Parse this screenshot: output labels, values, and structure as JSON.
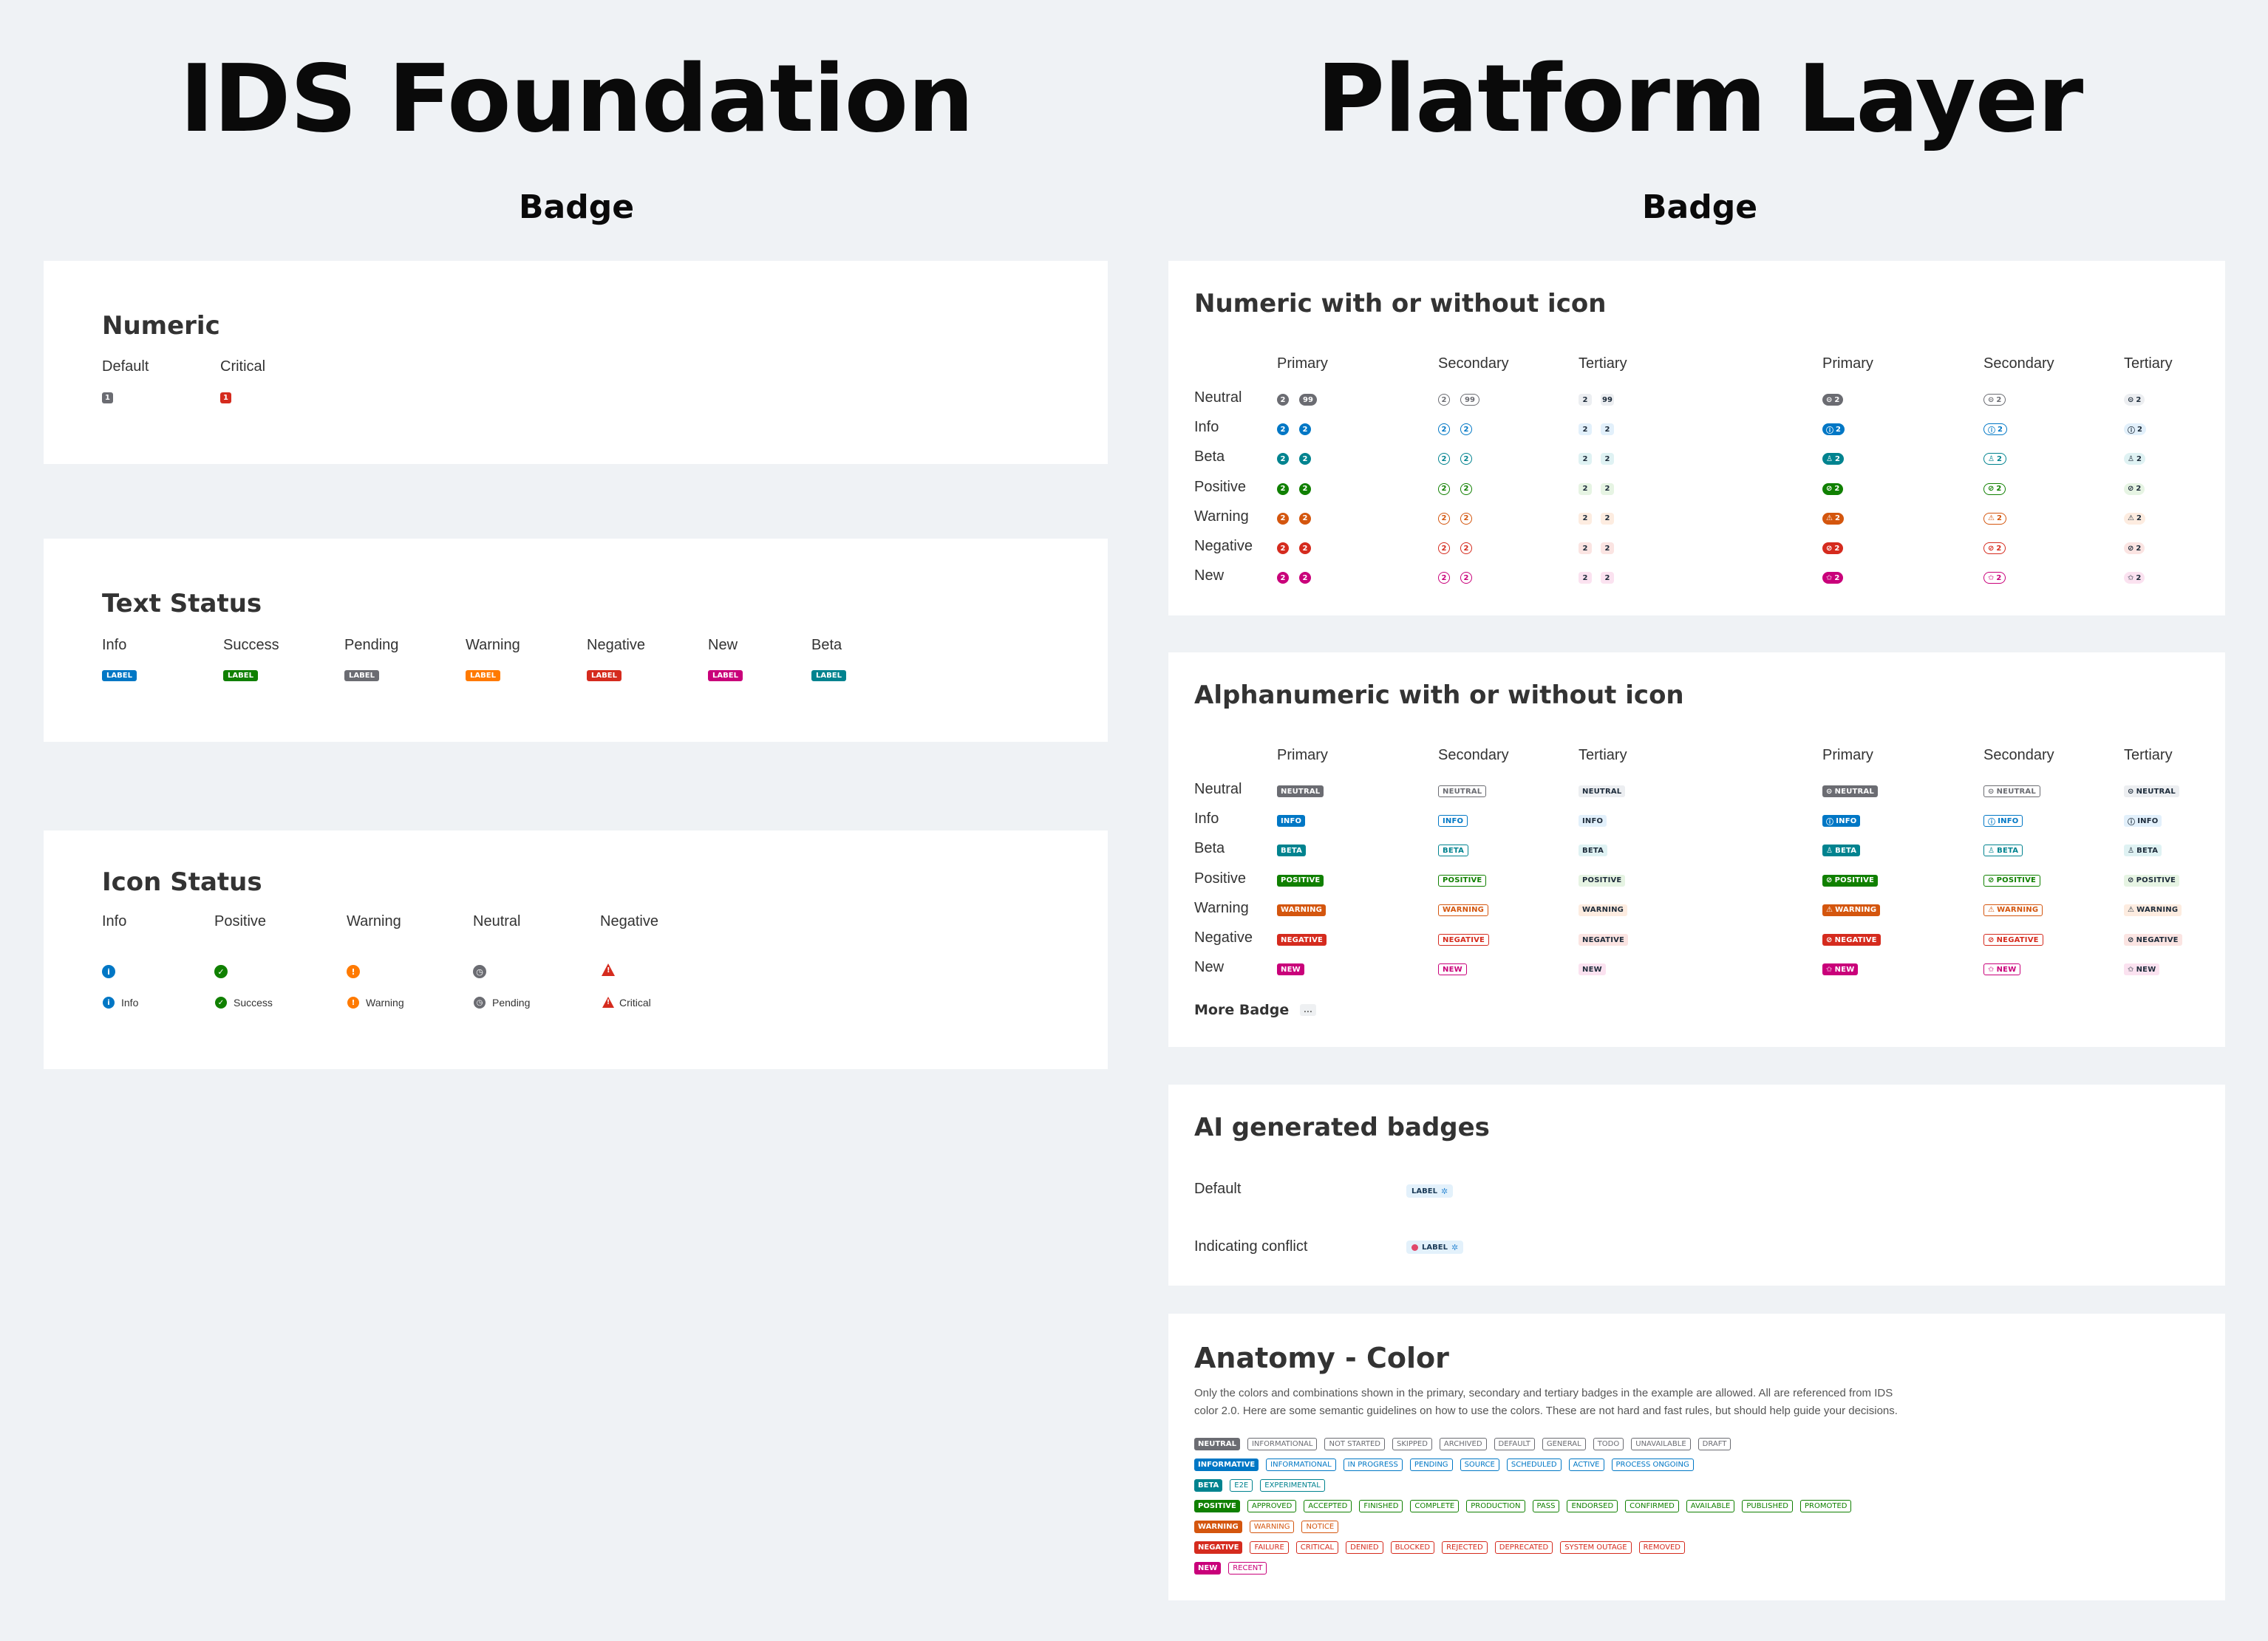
{
  "header": {
    "left_title": "IDS Foundation",
    "left_subtitle": "Badge",
    "right_title": "Platform Layer",
    "right_subtitle": "Badge"
  },
  "colors": {
    "neutral": "#6b6c72",
    "info": "#0077c5",
    "beta": "#00838f",
    "positive": "#108000",
    "warning": "#d4560e",
    "warning_foundation": "#ff7a00",
    "negative": "#d52b1e",
    "new": "#c9007a"
  },
  "foundation": {
    "numeric": {
      "title": "Numeric",
      "items": [
        {
          "label": "Default",
          "value": "1"
        },
        {
          "label": "Critical",
          "value": "1"
        }
      ]
    },
    "text_status": {
      "title": "Text Status",
      "badge_text": "LABEL",
      "items": [
        "Info",
        "Success",
        "Pending",
        "Warning",
        "Negative",
        "New",
        "Beta"
      ]
    },
    "icon_status": {
      "title": "Icon Status",
      "items": [
        {
          "label": "Info",
          "text": "Info",
          "icon": "info-icon"
        },
        {
          "label": "Positive",
          "text": "Success",
          "icon": "check-icon"
        },
        {
          "label": "Warning",
          "text": "Warning",
          "icon": "exclamation-icon"
        },
        {
          "label": "Neutral",
          "text": "Pending",
          "icon": "clock-icon"
        },
        {
          "label": "Negative",
          "text": "Critical",
          "icon": "alert-triangle-icon"
        }
      ]
    }
  },
  "platform": {
    "columns": [
      "Primary",
      "Secondary",
      "Tertiary",
      "Primary",
      "Secondary",
      "Tertiary"
    ],
    "rows": [
      "Neutral",
      "Info",
      "Beta",
      "Positive",
      "Warning",
      "Negative",
      "New"
    ],
    "numeric": {
      "title": "Numeric with or without icon",
      "value": "2",
      "big_value": "99"
    },
    "alphanumeric": {
      "title": "Alphanumeric with or without icon",
      "labels": [
        "NEUTRAL",
        "INFO",
        "BETA",
        "POSITIVE",
        "WARNING",
        "NEGATIVE",
        "NEW"
      ],
      "more_label": "More Badge",
      "more_badge": "..."
    },
    "ai": {
      "title": "AI generated badges",
      "rows": [
        {
          "label": "Default",
          "badge": "LABEL"
        },
        {
          "label": "Indicating conflict",
          "badge": "LABEL"
        }
      ]
    },
    "anatomy": {
      "title": "Anatomy - Color",
      "description_1": "Only the colors and combinations  shown in the primary, secondary and tertiary badges in the example are allowed. All are referenced from IDS",
      "description_2": "color 2.0. Here are some semantic guidelines on how to use the colors. These are not hard and fast rules, but should help guide your decisions.",
      "rows": [
        {
          "kind": "neutral",
          "primary": "NEUTRAL",
          "tags": [
            "INFORMATIONAL",
            "NOT STARTED",
            "SKIPPED",
            "ARCHIVED",
            "DEFAULT",
            "GENERAL",
            "TODO",
            "UNAVAILABLE",
            "DRAFT"
          ]
        },
        {
          "kind": "info",
          "primary": "INFORMATIVE",
          "tags": [
            "INFORMATIONAL",
            "IN PROGRESS",
            "PENDING",
            "SOURCE",
            "SCHEDULED",
            "ACTIVE",
            "PROCESS ONGOING"
          ]
        },
        {
          "kind": "beta",
          "primary": "BETA",
          "tags": [
            "E2E",
            "EXPERIMENTAL"
          ]
        },
        {
          "kind": "positive",
          "primary": "POSITIVE",
          "tags": [
            "APPROVED",
            "ACCEPTED",
            "FINISHED",
            "COMPLETE",
            "PRODUCTION",
            "PASS",
            "ENDORSED",
            "CONFIRMED",
            "AVAILABLE",
            "PUBLISHED",
            "PROMOTED"
          ]
        },
        {
          "kind": "warning",
          "primary": "WARNING",
          "tags": [
            "WARNING",
            "NOTICE"
          ]
        },
        {
          "kind": "negative",
          "primary": "NEGATIVE",
          "tags": [
            "FAILURE",
            "CRITICAL",
            "DENIED",
            "BLOCKED",
            "REJECTED",
            "DEPRECATED",
            "SYSTEM OUTAGE",
            "REMOVED"
          ]
        },
        {
          "kind": "new",
          "primary": "NEW",
          "tags": [
            "RECENT"
          ]
        }
      ]
    }
  }
}
